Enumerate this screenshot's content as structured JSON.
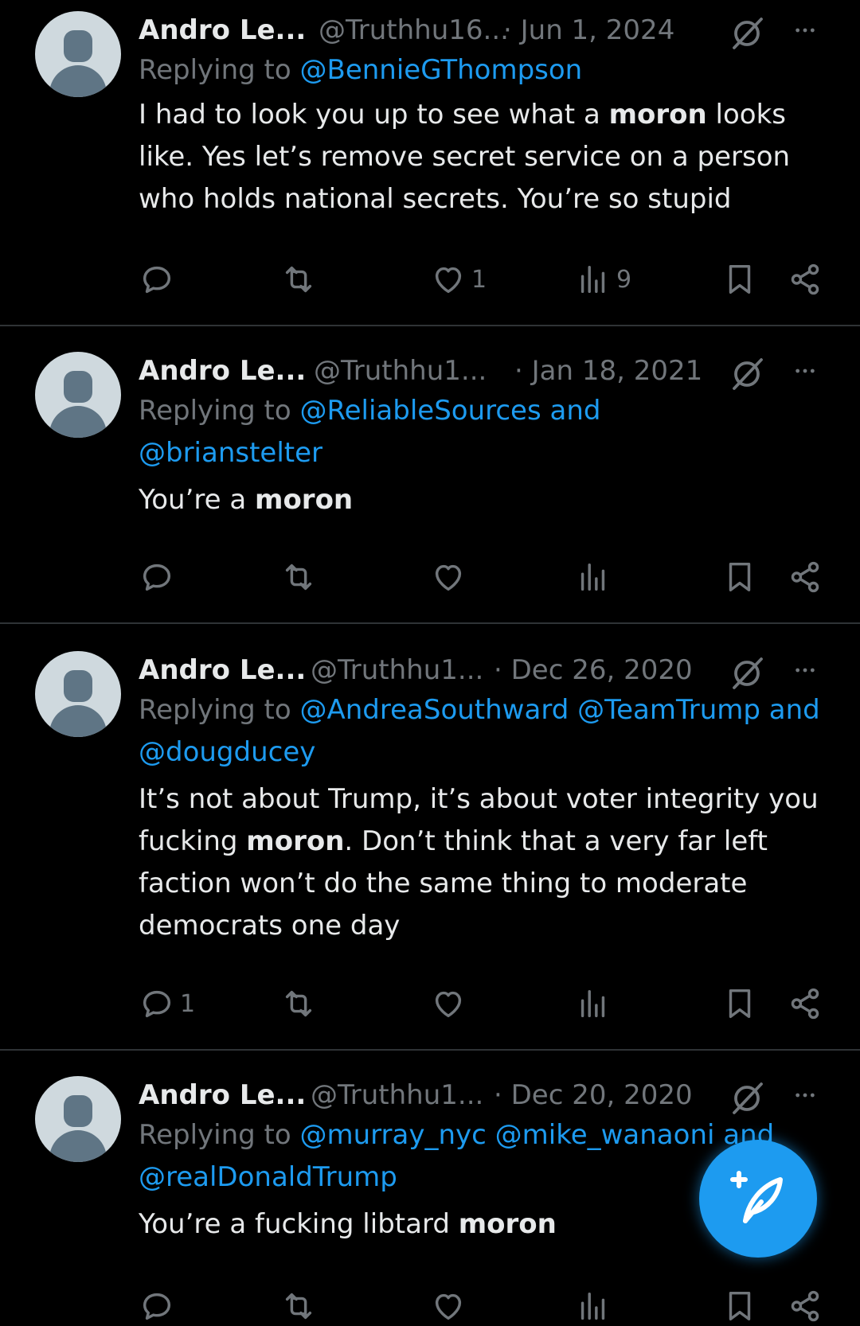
{
  "colors": {
    "background": "#000000",
    "text": "#e7e9ea",
    "muted": "#71767b",
    "accent": "#1d9bf0",
    "separator": "#2f3336"
  },
  "tweets": [
    {
      "name": "Andro Le...",
      "handle": "@Truthhu16...",
      "date": "· Jun 1, 2024",
      "reply_prefix": "Replying to",
      "mentions_text": "@BennieGThompson",
      "body_before": "I had to look you up to see what a ",
      "body_bold": "moron",
      "body_after": " looks like. Yes let’s remove secret service on a person who holds national secrets. You’re so stupid",
      "reply_count": "",
      "like_count": "1",
      "view_count": "9"
    },
    {
      "name": "Andro Le...",
      "handle": "@Truthhu1...",
      "date": "· Jan 18, 2021",
      "reply_prefix": "Replying to",
      "mentions_text": "@ReliableSources and @brianstelter",
      "body_before": "You’re a ",
      "body_bold": "moron",
      "body_after": "",
      "reply_count": "",
      "like_count": "",
      "view_count": ""
    },
    {
      "name": "Andro Le...",
      "handle": "@Truthhu1...",
      "date": "· Dec 26, 2020",
      "reply_prefix": "Replying to",
      "mentions_text": "@AndreaSouthward @TeamTrump and @dougducey",
      "body_before": "It’s not about Trump, it’s about voter integrity you fucking ",
      "body_bold": "moron",
      "body_after": ". Don’t think that a very far left faction won’t do the same thing to moderate democrats one day",
      "reply_count": "1",
      "like_count": "",
      "view_count": ""
    },
    {
      "name": "Andro Le...",
      "handle": "@Truthhu1...",
      "date": "· Dec 20, 2020",
      "reply_prefix": "Replying to",
      "mentions_text": "@murray_nyc @mike_wanaoni and @realDonaldTrump",
      "body_before": "You’re a fucking libtard ",
      "body_bold": "moron",
      "body_after": "",
      "reply_count": "",
      "like_count": "",
      "view_count": ""
    }
  ],
  "icons": {
    "grok": "grok-slash-icon",
    "more": "more-dots-icon",
    "reply": "reply-bubble-icon",
    "retweet": "retweet-icon",
    "like": "heart-icon",
    "views": "views-bars-icon",
    "bookmark": "bookmark-icon",
    "share": "share-icon",
    "compose": "compose-feather-icon"
  }
}
